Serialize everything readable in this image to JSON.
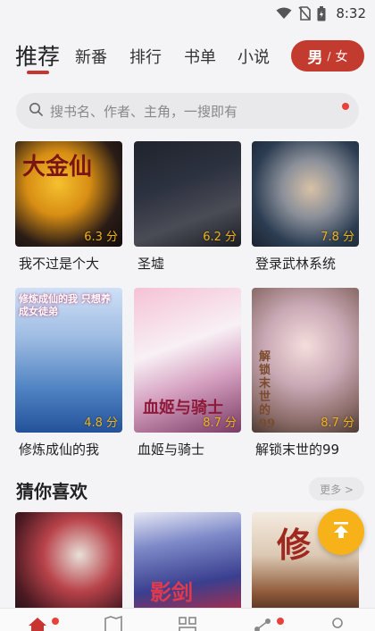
{
  "status_bar": {
    "time": "8:32",
    "icons": [
      "wifi-icon",
      "no-sim-icon",
      "battery-icon"
    ]
  },
  "tabs": [
    {
      "label": "推荐",
      "active": true
    },
    {
      "label": "新番"
    },
    {
      "label": "排行"
    },
    {
      "label": "书单"
    },
    {
      "label": "小说"
    }
  ],
  "gender_toggle": {
    "male": "男",
    "separator": "/",
    "female": "女"
  },
  "search": {
    "placeholder": "搜书名、作者、主角，一搜即有"
  },
  "books_row1": [
    {
      "title": "我不过是个大",
      "score": "6.3 分"
    },
    {
      "title": "圣墟",
      "score": "6.2 分"
    },
    {
      "title": "登录武林系统",
      "score": "7.8 分"
    }
  ],
  "books_row2": [
    {
      "title": "修炼成仙的我",
      "score": "4.8 分",
      "cover_text": "修炼成仙的我 只想养成女徒弟"
    },
    {
      "title": "血姬与骑士",
      "score": "8.7 分",
      "cover_text": "血姬与骑士"
    },
    {
      "title": "解锁末世的99",
      "score": "8.7 分",
      "cover_text": "解锁末世的99"
    }
  ],
  "cover_text_row1": {
    "first": "大金仙"
  },
  "section": {
    "title": "猜你喜欢",
    "more": "更多 >"
  },
  "guess_covers": [
    {
      "name": "guess-cover-1"
    },
    {
      "name": "guess-cover-2",
      "cover_text": "影剑"
    },
    {
      "name": "guess-cover-3",
      "cover_text": "修"
    }
  ],
  "colors": {
    "accent": "#c33a2e",
    "score": "#f2b318",
    "fab": "#f7b21a",
    "badge": "#e8413b"
  }
}
